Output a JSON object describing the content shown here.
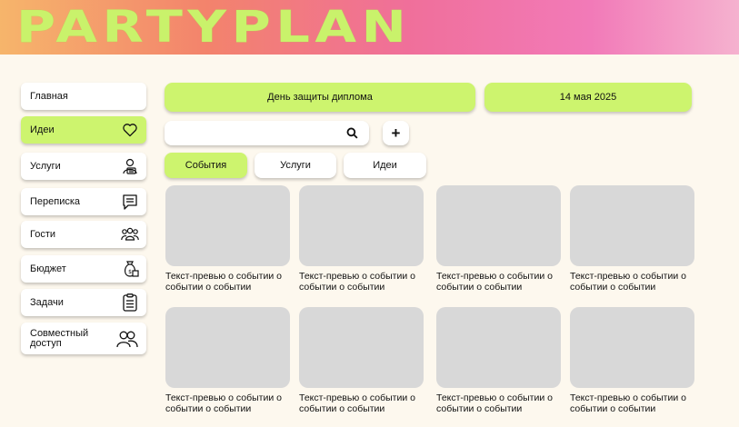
{
  "header": {
    "logo": "PARTYPLAN"
  },
  "sidebar": {
    "items": [
      {
        "label": "Главная",
        "icon": ""
      },
      {
        "label": "Идеи",
        "icon": "heart-icon",
        "active": true
      },
      {
        "label": "Услуги",
        "icon": "service-person-icon"
      },
      {
        "label": "Переписка",
        "icon": "chat-icon"
      },
      {
        "label": "Гости",
        "icon": "guests-icon"
      },
      {
        "label": "Бюджет",
        "icon": "money-bag-icon"
      },
      {
        "label": "Задачи",
        "icon": "checklist-icon"
      },
      {
        "label": "Совместный доступ",
        "icon": "shared-users-icon"
      }
    ]
  },
  "event": {
    "name": "День защиты диплома",
    "date": "14 мая 2025"
  },
  "search": {
    "value": "",
    "add_label": "+"
  },
  "tabs": [
    {
      "label": "События",
      "active": true
    },
    {
      "label": "Услуги"
    },
    {
      "label": "Идеи"
    }
  ],
  "cards": [
    {
      "text": "Текст-превью о событии о событии о событии"
    },
    {
      "text": "Текст-превью о событии о событии о событии"
    },
    {
      "text": "Текст-превью о событии о событии о событии"
    },
    {
      "text": "Текст-превью о событии о событии о событии"
    },
    {
      "text": "Текст-превью о событии о событии о событии"
    },
    {
      "text": "Текст-превью о событии о событии о событии"
    },
    {
      "text": "Текст-превью о событии о событии о событии"
    },
    {
      "text": "Текст-превью о событии о событии о событии"
    }
  ],
  "colors": {
    "accent": "#cdf46e",
    "background": "#fdf8ee",
    "placeholder": "#d8d8d8"
  }
}
